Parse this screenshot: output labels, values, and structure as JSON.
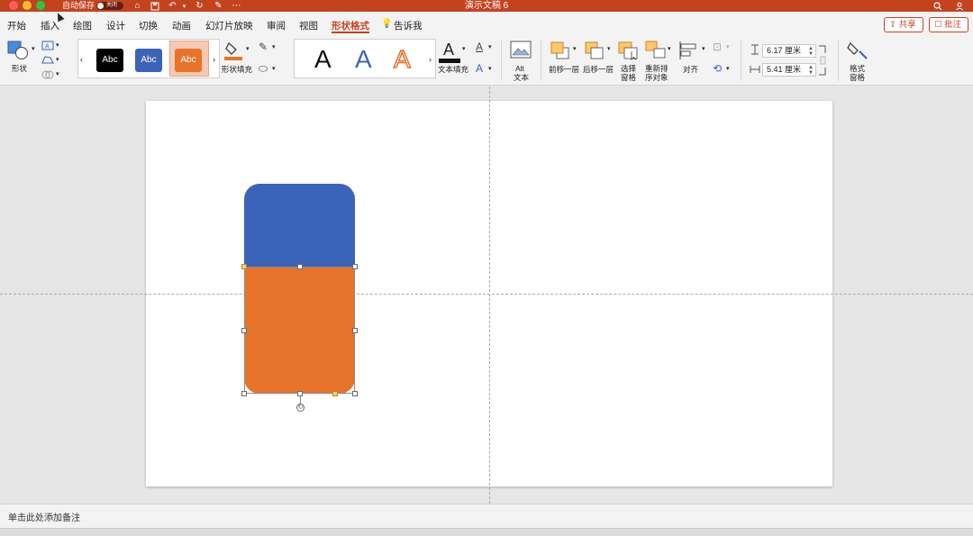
{
  "window": {
    "title": "演示文稿 6",
    "autosave_label": "自动保存",
    "autosave_state": "关闭"
  },
  "tabs": [
    {
      "label": "开始"
    },
    {
      "label": "插入"
    },
    {
      "label": "绘图"
    },
    {
      "label": "设计"
    },
    {
      "label": "切换"
    },
    {
      "label": "动画"
    },
    {
      "label": "幻灯片放映"
    },
    {
      "label": "审阅"
    },
    {
      "label": "视图"
    },
    {
      "label": "形状格式"
    },
    {
      "label": "告诉我"
    }
  ],
  "header_buttons": {
    "share": "共享",
    "comment": "批注"
  },
  "ribbon": {
    "shape_label": "形状",
    "shape_styles": [
      {
        "text": "Abc",
        "color": "#000000"
      },
      {
        "text": "Abc",
        "color": "#3b63ba"
      },
      {
        "text": "Abc",
        "color": "#e8732b"
      }
    ],
    "shape_fill_label": "形状填充",
    "wordart": [
      {
        "text": "A",
        "color": "#111111"
      },
      {
        "text": "A",
        "color": "#3b63ba"
      },
      {
        "text": "A",
        "color": "#e8732b"
      }
    ],
    "text_fill_label": "文本填充",
    "alt_text_label_1": "Alt",
    "alt_text_label_2": "文本",
    "bring_forward_label": "前移一层",
    "send_backward_label": "后移一层",
    "selection_pane_label_1": "选择",
    "selection_pane_label_2": "窗格",
    "reorder_label_1": "重新排",
    "reorder_label_2": "序对象",
    "align_label": "对齐",
    "height_value": "6.17 厘米",
    "width_value": "5.41 厘米",
    "format_pane_label_1": "格式",
    "format_pane_label_2": "窗格"
  },
  "notes": {
    "placeholder": "单击此处添加备注"
  },
  "colors": {
    "accent": "#c4431f",
    "shape_blue": "#3b63ba",
    "shape_orange": "#e8732b"
  }
}
